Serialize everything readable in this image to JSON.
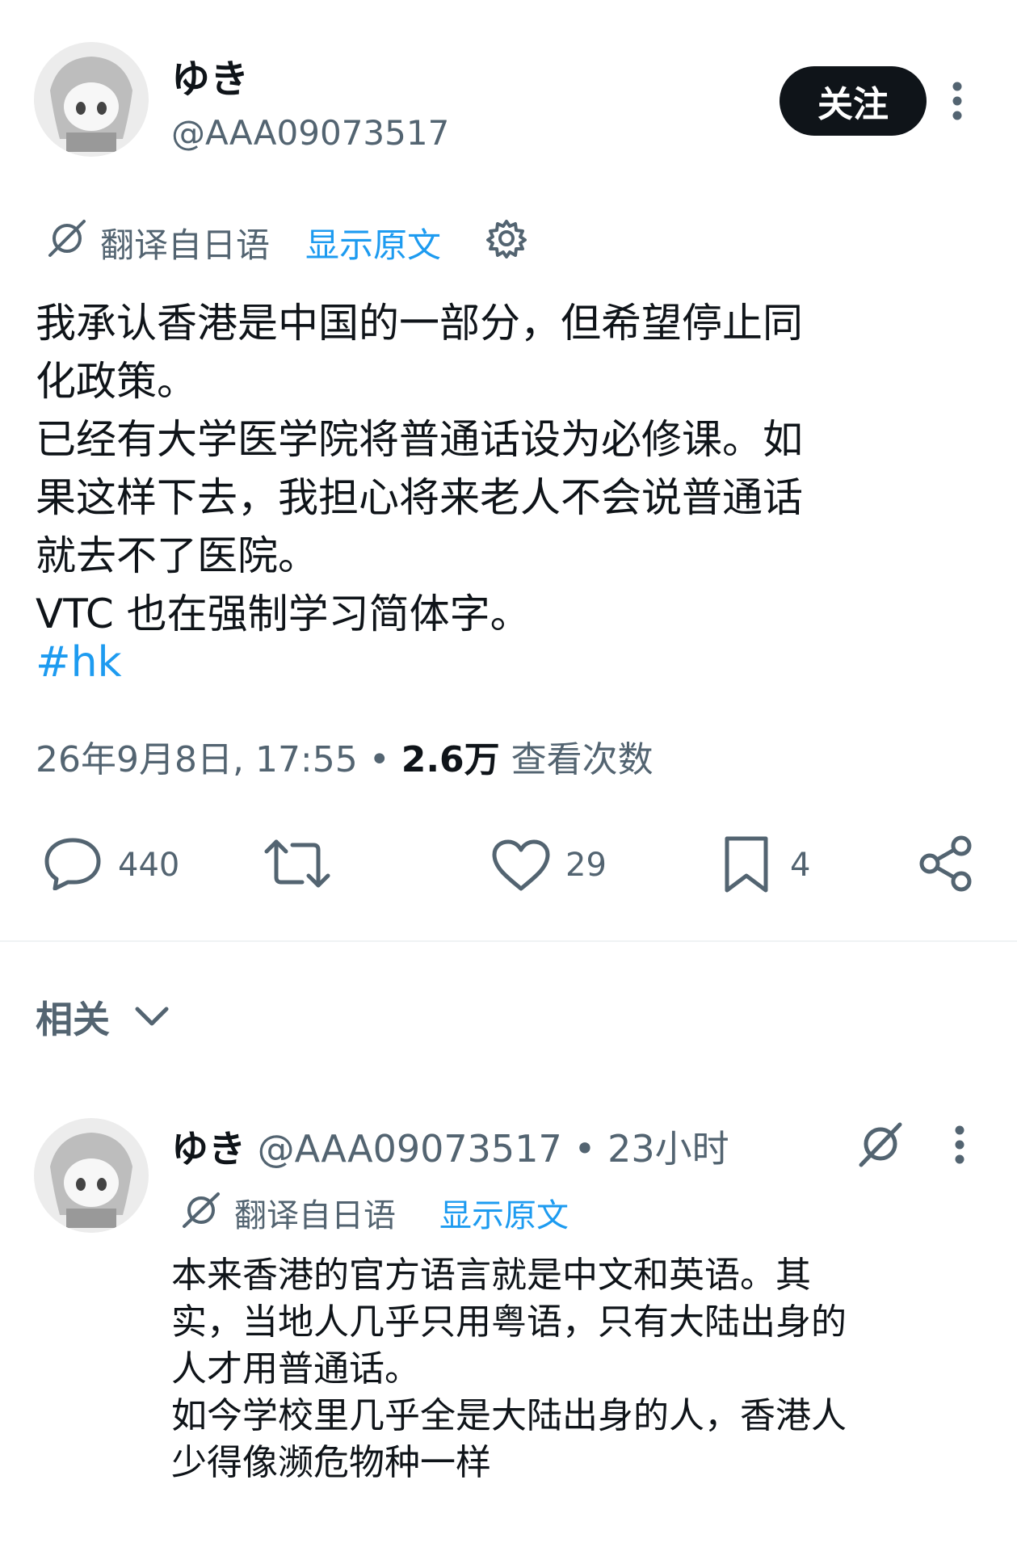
{
  "post": {
    "display_name": "ゆき",
    "handle": "@AAA09073517",
    "follow_label": "关注",
    "translated_from": "翻译自日语",
    "show_original": "显示原文",
    "body": "我承认香港是中国的一部分，但希望停止同\n化政策。\n已经有大学医学院将普通话设为必修课。如\n果这样下去，我担心将来老人不会说普通话\n就去不了医院。\nVTC 也在强制学习简体字。",
    "hashtag": "#hk",
    "timestamp": "26年9月8日, 17:55",
    "dot": "•",
    "views_count": "2.6万",
    "views_label": "查看次数",
    "replies": "440",
    "likes": "29",
    "bookmarks": "4"
  },
  "related": {
    "label": "相关"
  },
  "reply": {
    "display_name": "ゆき",
    "handle": "@AAA09073517",
    "dot": "•",
    "time_ago": "23小时",
    "translated_from": "翻译自日语",
    "show_original": "显示原文",
    "body": "本来香港的官方语言就是中文和英语。其\n实，当地人几乎只用粤语，只有大陆出身的\n人才用普通话。\n如今学校里几乎全是大陆出身的人，香港人\n少得像濒危物种一样"
  },
  "colors": {
    "text": "#0f1419",
    "secondary": "#536471",
    "link": "#1d9bf0"
  }
}
